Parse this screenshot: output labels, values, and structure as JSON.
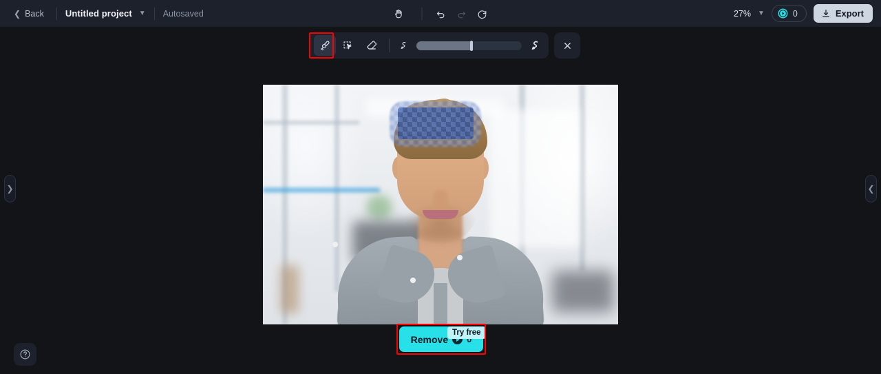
{
  "header": {
    "back_label": "Back",
    "back_icon": "chevron-left-icon",
    "project_name": "Untitled project",
    "project_caret_icon": "chevron-down-icon",
    "autosave_status": "Autosaved",
    "pan_icon": "hand-icon",
    "undo_icon": "undo-arrow-icon",
    "redo_icon": "redo-arrow-icon",
    "reset_icon": "refresh-icon",
    "zoom_level": "27%",
    "zoom_caret_icon": "chevron-down-icon",
    "credit_icon": "credit-token-icon",
    "credit_count": "0",
    "export_icon": "download-icon",
    "export_label": "Export"
  },
  "toolbar": {
    "brush_icon": "paint-brush-icon",
    "select_icon": "magic-select-cursor-icon",
    "eraser_icon": "eraser-icon",
    "small_brush_icon": "small-brush-stroke-icon",
    "large_brush_icon": "large-brush-stroke-icon",
    "close_icon": "close-x-icon",
    "brush_size_percent": 52,
    "active_tool": "brush"
  },
  "canvas": {
    "mask_label": "selection-mask-overlay",
    "photo_alt": "portrait of a man in a gray shirt in a bright office"
  },
  "action": {
    "remove_label": "Remove",
    "remove_cost_icon": "credit-token-icon",
    "remove_cost": "0",
    "tooltip_label": "Try free"
  },
  "panels": {
    "left_handle_icon": "chevron-right-icon",
    "right_handle_icon": "chevron-left-icon",
    "help_icon": "question-mark-circle-icon"
  },
  "colors": {
    "header_bg": "#1d212c",
    "canvas_bg": "#121418",
    "accent_cyan": "#27e0e8",
    "annotation_red": "#fe0000",
    "export_bg": "#cdd6e1"
  }
}
